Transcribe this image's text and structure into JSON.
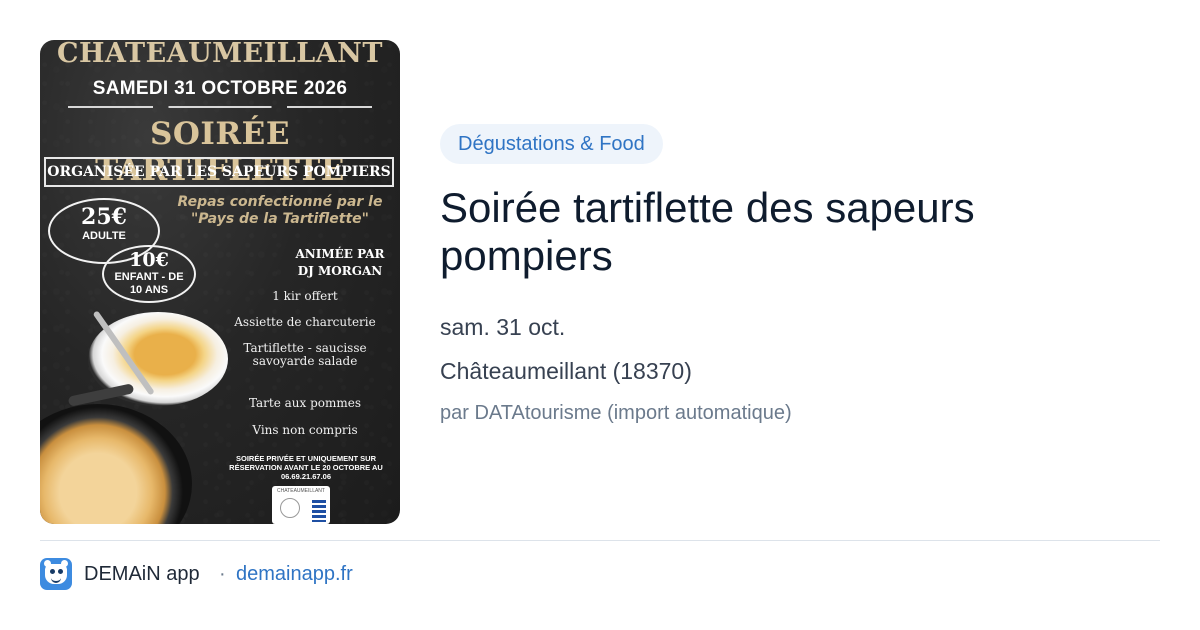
{
  "poster": {
    "town": "CHATEAUMEILLANT",
    "date": "SAMEDI 31 OCTOBRE 2026",
    "title": "SOIRÉE TARTIFLETTE",
    "organizer": "ORGANISÉE PAR LES SAPEURS POMPIERS",
    "repas": "Repas confectionné par le \"Pays de la Tartiflette\"",
    "price_adult": "25€",
    "price_adult_label": "ADULTE",
    "price_child": "10€",
    "price_child_label_1": "ENFANT - DE",
    "price_child_label_2": "10 ANS",
    "anim_1": "ANIMÉE PAR",
    "anim_2": "DJ MORGAN",
    "menu_1": "1 kir offert",
    "menu_2": "Assiette de charcuterie",
    "menu_3": "Tartiflette - saucisse savoyarde salade",
    "menu_4": "Tarte aux pommes",
    "menu_5": "Vins non compris",
    "footer": "SOIRÉE PRIVÉE ET UNIQUEMENT SUR RÉSERVATION AVANT LE 20 OCTOBRE AU 06.69.21.67.06",
    "logo_text": "CHATEAUMEILLANT"
  },
  "event": {
    "category": "Dégustations & Food",
    "title": "Soirée tartiflette des sapeurs pompiers",
    "date": "sam. 31 oct.",
    "location": "Châteaumeillant (18370)",
    "source": "par DATAtourisme (import automatique)"
  },
  "footer": {
    "app_name": "DEMAiN app",
    "separator": "·",
    "domain": "demainapp.fr"
  },
  "colors": {
    "accent": "#2f74c4",
    "badge_bg": "#eef4fb",
    "title": "#0f1c2e",
    "muted": "#6b7a8c"
  }
}
